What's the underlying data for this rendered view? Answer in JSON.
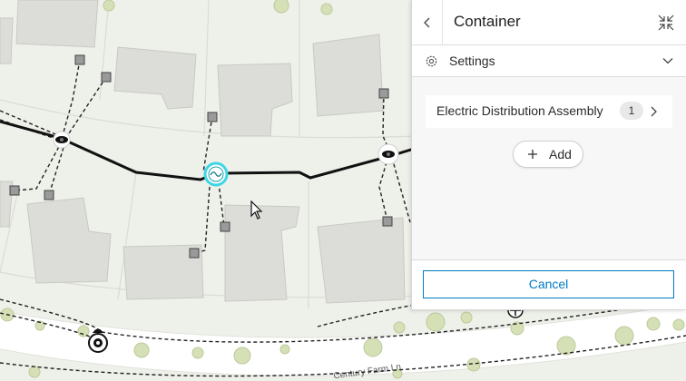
{
  "panel": {
    "title": "Container",
    "settings_label": "Settings",
    "assembly_label": "Electric Distribution Assembly",
    "assembly_count": "1",
    "add_label": "Add",
    "cancel_label": "Cancel"
  },
  "map": {
    "street_label": "Century Farm Ln"
  },
  "colors": {
    "accent": "#007ac2",
    "selection": "#3fd6e6"
  },
  "icons": {
    "back": "chevron-left-icon",
    "collapse": "collapse-icon",
    "settings": "gear-icon",
    "settings_toggle": "chevron-down-icon",
    "assembly_open": "chevron-right-icon",
    "add": "plus-icon",
    "pointer": "mouse-cursor-icon"
  }
}
